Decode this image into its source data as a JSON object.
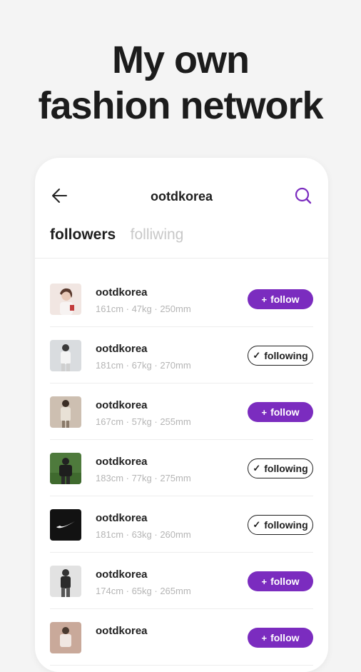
{
  "headline": {
    "line1": "My own",
    "line2": "fashion network"
  },
  "topbar": {
    "title": "ootdkorea"
  },
  "tabs": [
    {
      "label": "followers",
      "active": true
    },
    {
      "label": "folliwing",
      "active": false
    }
  ],
  "accent_color": "#7b2cbf",
  "users": [
    {
      "name": "ootdkorea",
      "meta": "161cm · 47kg · 250mm",
      "button": "follow",
      "button_icon": "+"
    },
    {
      "name": "ootdkorea",
      "meta": "181cm · 67kg · 270mm",
      "button": "following",
      "button_icon": "✓"
    },
    {
      "name": "ootdkorea",
      "meta": "167cm · 57kg · 255mm",
      "button": "follow",
      "button_icon": "+"
    },
    {
      "name": "ootdkorea",
      "meta": "183cm · 77kg · 275mm",
      "button": "following",
      "button_icon": "✓"
    },
    {
      "name": "ootdkorea",
      "meta": "181cm · 63kg · 260mm",
      "button": "following",
      "button_icon": "✓"
    },
    {
      "name": "ootdkorea",
      "meta": "174cm · 65kg · 265mm",
      "button": "follow",
      "button_icon": "+"
    },
    {
      "name": "ootdkorea",
      "meta": "",
      "button": "follow",
      "button_icon": "+"
    }
  ]
}
